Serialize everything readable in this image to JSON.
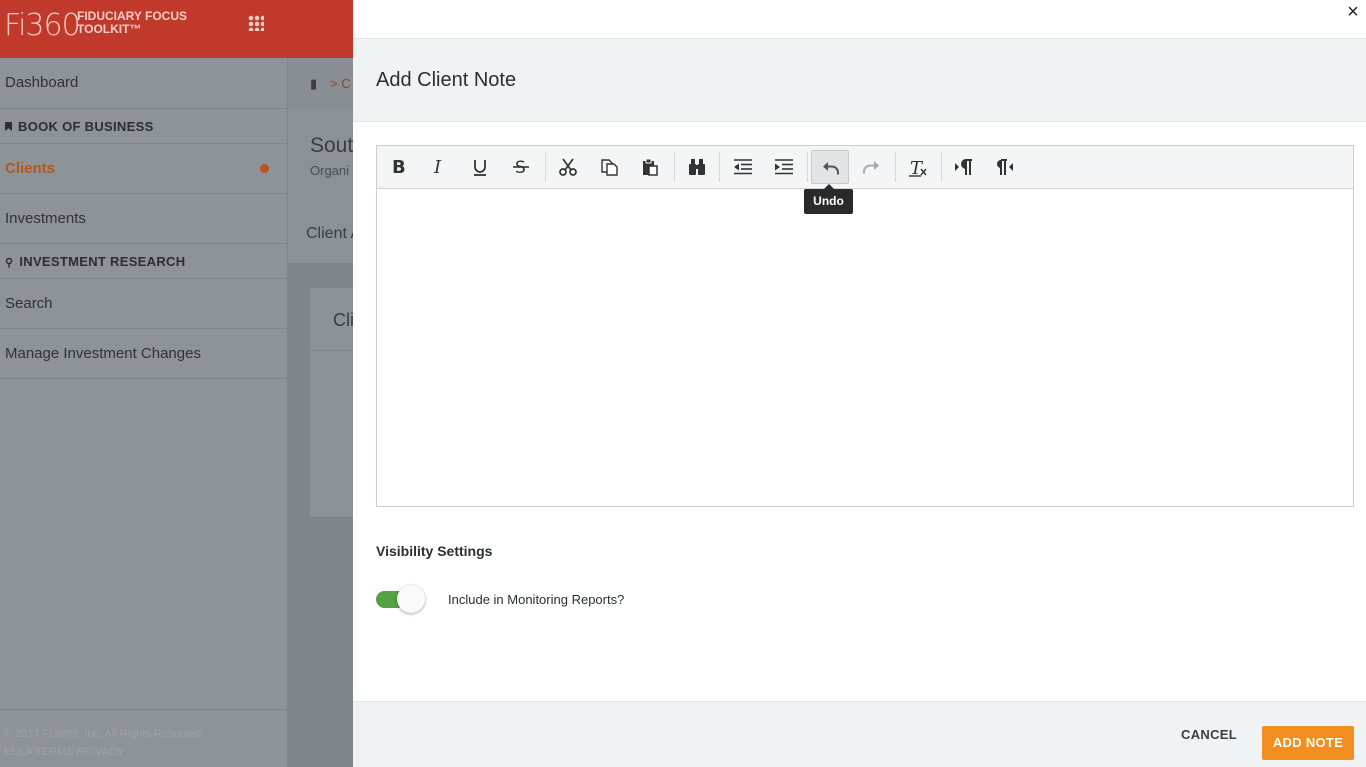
{
  "brand": {
    "logo_text": "Fi360",
    "name": "FIDUCIARY FOCUS TOOLKIT™"
  },
  "sidebar": {
    "dashboard": "Dashboard",
    "book_header": "BOOK OF BUSINESS",
    "clients": "Clients",
    "investments": "Investments",
    "research_header": "INVESTMENT RESEARCH",
    "search": "Search",
    "manage": "Manage Investment Changes"
  },
  "footer": {
    "copyright": "© 2017 Fi360®, Inc. All Rights Reserved",
    "links": "EULA  TERMS  PRIVACY"
  },
  "background": {
    "crumb": "> C",
    "client_title": "Sout",
    "client_sub": "Organi",
    "tab": "Client A",
    "card_title": "Cli"
  },
  "modal": {
    "close": "×",
    "title": "Add Client Note",
    "tooltip": "Undo",
    "visibility_title": "Visibility Settings",
    "toggle_label": "Include in Monitoring Reports?",
    "toggle_on": true,
    "cancel_label": "CANCEL",
    "add_label": "ADD NOTE"
  },
  "toolbar": {
    "buttons": [
      "bold-icon",
      "italic-icon",
      "underline-icon",
      "strikethrough-icon",
      "cut-icon",
      "copy-icon",
      "paste-icon",
      "find-icon",
      "outdent-icon",
      "indent-icon",
      "undo-icon",
      "redo-icon",
      "remove-format-icon",
      "ltr-icon",
      "rtl-icon"
    ],
    "active": "undo-icon"
  },
  "colors": {
    "brand_red": "#c0392b",
    "accent_orange": "#f28e1e",
    "toggle_green": "#56a047",
    "active_link": "#b8561c"
  }
}
